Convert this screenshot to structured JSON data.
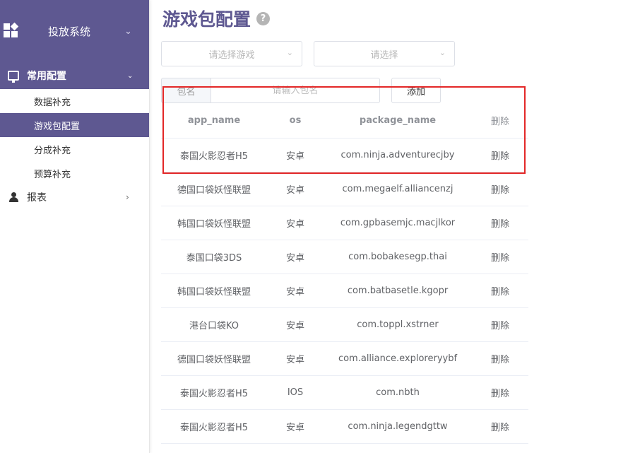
{
  "sidebar": {
    "brand_title": "投放系统",
    "group": {
      "label": "常用配置"
    },
    "sub_items": [
      {
        "label": "数据补充"
      },
      {
        "label": "游戏包配置"
      },
      {
        "label": "分成补充"
      },
      {
        "label": "预算补充"
      }
    ],
    "reports": {
      "label": "报表"
    }
  },
  "main": {
    "title": "游戏包配置",
    "help_icon": "?",
    "game_select_placeholder": "请选择游戏",
    "second_select_placeholder": "请选择",
    "input_prefix": "包名",
    "input_placeholder": "请输入包名",
    "add_button": "添加"
  },
  "table": {
    "headers": [
      "app_name",
      "os",
      "package_name",
      "删除"
    ],
    "rows": [
      [
        "泰国火影忍者H5",
        "安卓",
        "com.ninja.adventurecjby",
        "删除"
      ],
      [
        "德国口袋妖怪联盟",
        "安卓",
        "com.megaelf.alliancenzj",
        "删除"
      ],
      [
        "韩国口袋妖怪联盟",
        "安卓",
        "com.gpbasemjc.macjlkor",
        "删除"
      ],
      [
        "泰国口袋3DS",
        "安卓",
        "com.bobakesegp.thai",
        "删除"
      ],
      [
        "韩国口袋妖怪联盟",
        "安卓",
        "com.batbasetle.kgopr",
        "删除"
      ],
      [
        "港台口袋KO",
        "安卓",
        "com.toppl.xstrner",
        "删除"
      ],
      [
        "德国口袋妖怪联盟",
        "安卓",
        "com.alliance.exploreryybf",
        "删除"
      ],
      [
        "泰国火影忍者H5",
        "IOS",
        "com.nbth",
        "删除"
      ],
      [
        "泰国火影忍者H5",
        "安卓",
        "com.ninja.legendgttw",
        "删除"
      ]
    ]
  },
  "colors": {
    "accent": "#5e5891",
    "highlight": "#e32727"
  }
}
